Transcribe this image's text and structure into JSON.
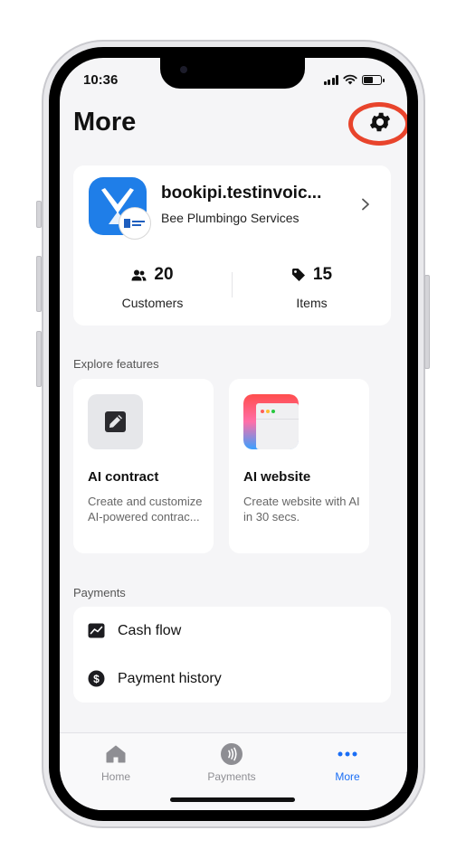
{
  "status_bar": {
    "time": "10:36"
  },
  "header": {
    "title": "More"
  },
  "profile": {
    "business_name": "bookipi.testinvoic...",
    "subtitle": "Bee Plumbingo Services",
    "stats": [
      {
        "value": "20",
        "label": "Customers",
        "icon": "users-icon"
      },
      {
        "value": "15",
        "label": "Items",
        "icon": "tag-icon"
      }
    ]
  },
  "explore": {
    "section_label": "Explore features",
    "features": [
      {
        "title": "AI contract",
        "description": "Create and customize AI-powered contrac...",
        "icon": "contract-edit-icon"
      },
      {
        "title": "AI website",
        "description": "Create website with AI in 30 secs.",
        "icon": "website-window-icon"
      }
    ]
  },
  "payments": {
    "section_label": "Payments",
    "items": [
      {
        "label": "Cash flow",
        "icon": "chart-line-icon"
      },
      {
        "label": "Payment history",
        "icon": "dollar-circle-icon"
      }
    ]
  },
  "tabbar": {
    "tabs": [
      {
        "label": "Home",
        "icon": "home-icon",
        "active": false
      },
      {
        "label": "Payments",
        "icon": "contactless-icon",
        "active": false
      },
      {
        "label": "More",
        "icon": "more-dots-icon",
        "active": true
      }
    ]
  },
  "colors": {
    "accent": "#1a6ef5",
    "highlight_ring": "#e8442c",
    "brand_blue": "#1f7ee8",
    "screen_bg": "#f5f5f7"
  }
}
